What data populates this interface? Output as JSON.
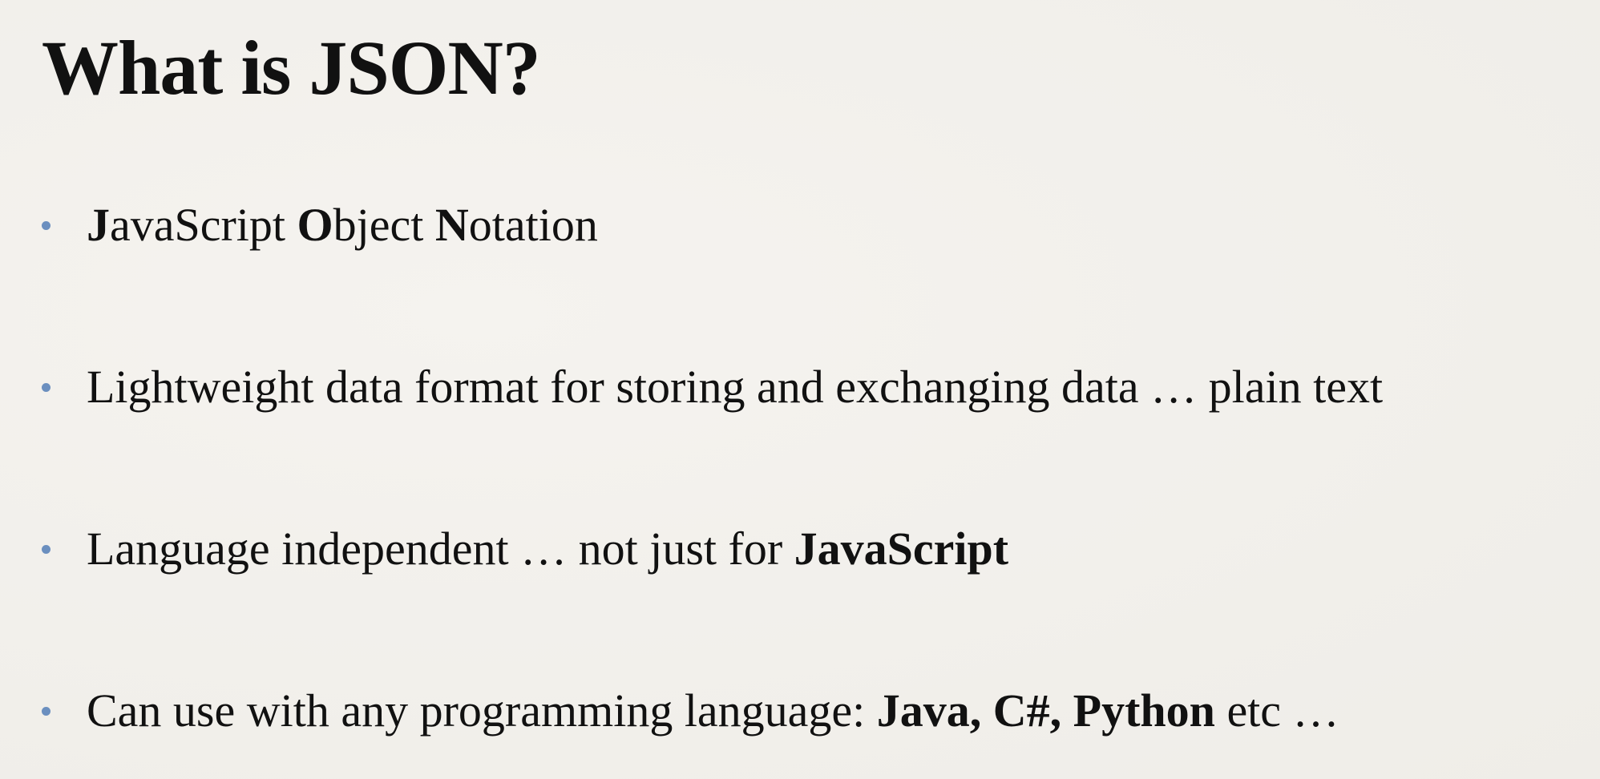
{
  "slide": {
    "title": "What is JSON?",
    "bullets": [
      {
        "segments": [
          {
            "text": "J",
            "bold": true
          },
          {
            "text": "avaS",
            "bold": false
          },
          {
            "text": "cript ",
            "bold": false
          },
          {
            "text": "O",
            "bold": true
          },
          {
            "text": "bject ",
            "bold": false
          },
          {
            "text": "N",
            "bold": true
          },
          {
            "text": "otation",
            "bold": false
          }
        ]
      },
      {
        "segments": [
          {
            "text": "Lightweight data format for storing and exchanging data … plain text",
            "bold": false
          }
        ]
      },
      {
        "segments": [
          {
            "text": "Language independent … not just for ",
            "bold": false
          },
          {
            "text": "JavaScript",
            "bold": true
          }
        ]
      },
      {
        "segments": [
          {
            "text": "Can use with any programming language: ",
            "bold": false
          },
          {
            "text": "Java, C#, Python",
            "bold": true
          },
          {
            "text": " etc …",
            "bold": false
          }
        ]
      }
    ],
    "bullet_color": "#6b8fbf"
  }
}
